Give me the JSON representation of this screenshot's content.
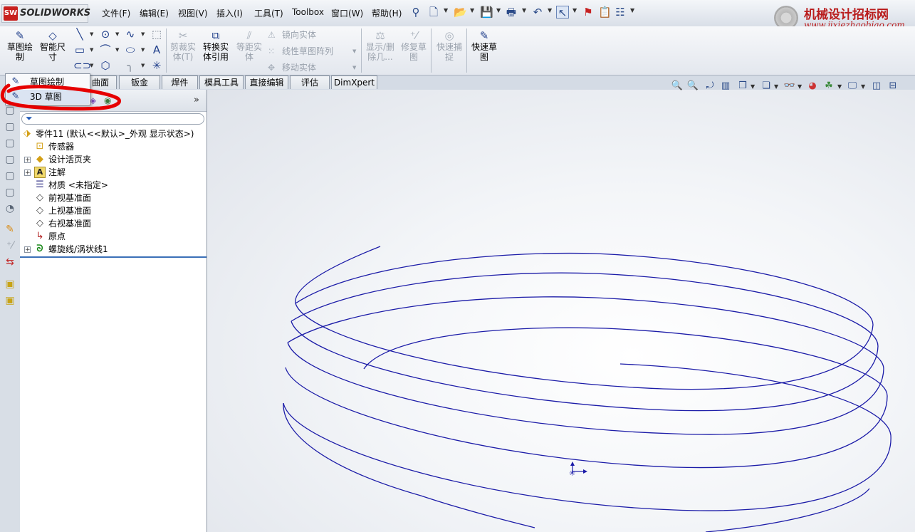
{
  "app": {
    "logo_text": "SOLIDWORKS",
    "logo_badge": "SW"
  },
  "menu": [
    "文件(F)",
    "编辑(E)",
    "视图(V)",
    "插入(I)",
    "工具(T)",
    "Toolbox",
    "窗口(W)",
    "帮助(H)"
  ],
  "watermark": {
    "line1": "机械设计招标网",
    "line2": "www.jixiezhaobiao.com"
  },
  "command_manager": {
    "sketch_label": "草图绘\n制",
    "smart_dim_label": "智能尺\n寸",
    "trim_label": "剪裁实\n体(T)",
    "convert_label": "转换实\n体引用",
    "offset_label": "等距实\n体",
    "mirror_label": "镜向实体",
    "linear_pattern_label": "线性草图阵列",
    "move_label": "移动实体",
    "show_delete_label": "显示/删\n除几...",
    "repair_label": "修复草\n图",
    "quick_snap_label": "快速捕\n捉",
    "rapid_sketch_label": "快速草\n图"
  },
  "tabs": [
    "曲面",
    "钣金",
    "焊件",
    "模具工具",
    "直接编辑",
    "评估",
    "DimXpert"
  ],
  "dropdown": {
    "item1": "草图绘制",
    "item2": "3D 草图"
  },
  "feature_tree": {
    "part": "零件11  (默认<<默认>_外观 显示状态>)",
    "items": [
      {
        "label": "传感器",
        "icon": "sensor-icon",
        "expandable": false
      },
      {
        "label": "设计活页夹",
        "icon": "design-binder-icon",
        "expandable": true
      },
      {
        "label": "注解",
        "icon": "annotations-icon",
        "expandable": true
      },
      {
        "label": "材质 <未指定>",
        "icon": "material-icon",
        "expandable": false
      },
      {
        "label": "前视基准面",
        "icon": "plane-icon",
        "expandable": false
      },
      {
        "label": "上视基准面",
        "icon": "plane-icon",
        "expandable": false
      },
      {
        "label": "右视基准面",
        "icon": "plane-icon",
        "expandable": false
      },
      {
        "label": "原点",
        "icon": "origin-icon",
        "expandable": false
      },
      {
        "label": "螺旋线/涡状线1",
        "icon": "helix-icon",
        "expandable": true
      }
    ]
  },
  "colors": {
    "helix": "#1c1ca8",
    "highlight": "#e60000",
    "tree_bottom": "#3a6fb7"
  }
}
